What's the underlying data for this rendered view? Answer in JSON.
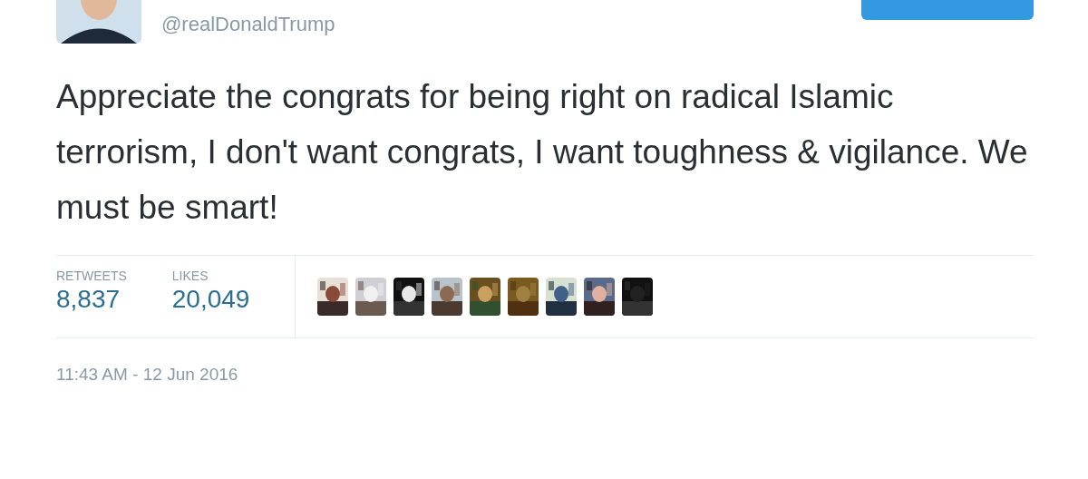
{
  "author": {
    "handle": "@realDonaldTrump"
  },
  "tweet": {
    "text": "Appreciate the congrats for being right on radical Islamic terrorism, I don't want congrats, I want toughness & vigilance. We must be smart!"
  },
  "stats": [
    {
      "label": "RETWEETS",
      "value": "8,837"
    },
    {
      "label": "LIKES",
      "value": "20,049"
    }
  ],
  "timestamp": "11:43 AM - 12 Jun 2016"
}
